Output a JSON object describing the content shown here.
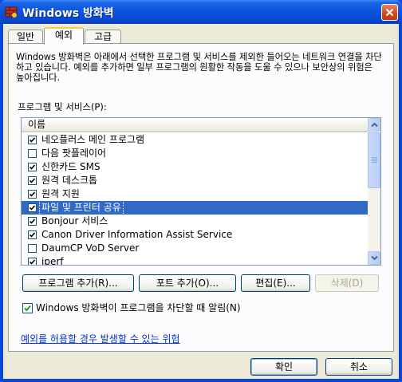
{
  "window": {
    "title": "Windows 방화벽"
  },
  "tabs": [
    {
      "label": "일반",
      "active": false
    },
    {
      "label": "예외",
      "active": true
    },
    {
      "label": "고급",
      "active": false
    }
  ],
  "exceptions": {
    "description": "Windows 방화벽은 아래에서 선택한 프로그램 및 서비스를 제외한 들어오는 네트워크 연결을 차단하고 있습니다. 예외를 추가하면 일부 프로그램의 원활한 작동을 도울 수 있으나 보안상의 위험은 높아집니다.",
    "list_label": "프로그램 및 서비스(P):",
    "column_header": "이름",
    "items": [
      {
        "label": "네오플러스 메인 프로그램",
        "checked": true,
        "selected": false
      },
      {
        "label": "다음 팟플레이어",
        "checked": false,
        "selected": false
      },
      {
        "label": "신한카드 SMS",
        "checked": true,
        "selected": false
      },
      {
        "label": "원격 데스크톱",
        "checked": true,
        "selected": false
      },
      {
        "label": "원격 지원",
        "checked": true,
        "selected": false
      },
      {
        "label": "파일 및 프린터 공유",
        "checked": true,
        "selected": true
      },
      {
        "label": "Bonjour 서비스",
        "checked": true,
        "selected": false
      },
      {
        "label": "Canon Driver Information Assist Service",
        "checked": true,
        "selected": false
      },
      {
        "label": "DaumCP VoD Server",
        "checked": false,
        "selected": false
      },
      {
        "label": "iperf",
        "checked": true,
        "selected": false
      }
    ],
    "buttons": {
      "add_program": "프로그램 추가(R)...",
      "add_port": "포트 추가(O)...",
      "edit": "편집(E)...",
      "delete": "삭제(D)"
    },
    "notify": {
      "label": "Windows 방화벽이 프로그램을 차단할 때 알림(N)",
      "checked": true
    },
    "risk_link": "예외를 허용할 경우 발생할 수 있는 위험"
  },
  "dialog_buttons": {
    "ok": "확인",
    "cancel": "취소"
  },
  "colors": {
    "selection": "#316ac5",
    "titlebar": "#0a52dc",
    "dialog_bg": "#ece9d8",
    "link": "#0033cc"
  }
}
